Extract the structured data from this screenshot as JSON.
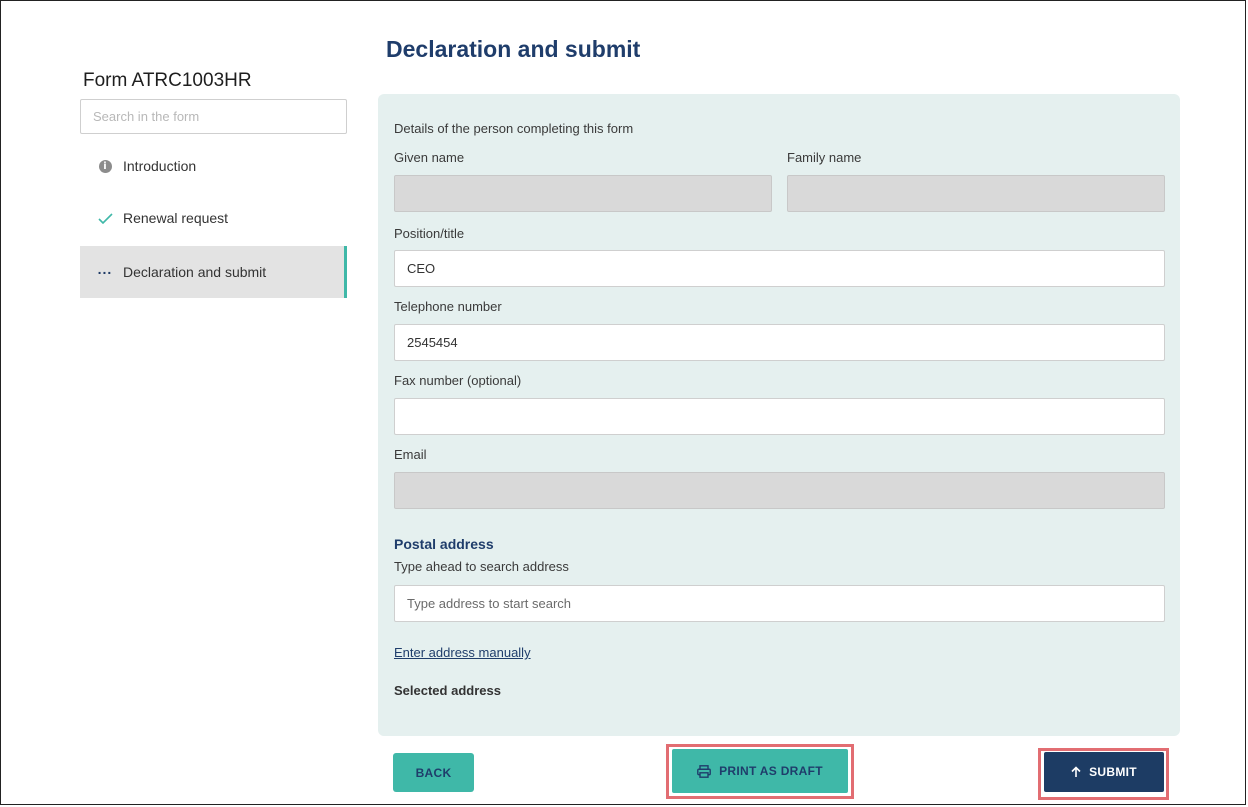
{
  "sidebar": {
    "form_title": "Form ATRC1003HR",
    "search_placeholder": "Search in the form",
    "items": [
      {
        "label": "Introduction",
        "icon": "info-icon",
        "state": "info"
      },
      {
        "label": "Renewal request",
        "icon": "check-icon",
        "state": "complete"
      },
      {
        "label": "Declaration and submit",
        "icon": "more-dots-icon",
        "state": "in-progress"
      }
    ]
  },
  "main": {
    "title": "Declaration and submit",
    "section_intro": "Details of the person completing this form",
    "fields": {
      "given_name": {
        "label": "Given name",
        "value": ""
      },
      "family_name": {
        "label": "Family name",
        "value": ""
      },
      "position": {
        "label": "Position/title",
        "value": "CEO"
      },
      "telephone": {
        "label": "Telephone number",
        "value": "2545454"
      },
      "fax": {
        "label": "Fax number (optional)",
        "value": ""
      },
      "email": {
        "label": "Email",
        "value": ""
      }
    },
    "postal": {
      "heading": "Postal address",
      "hint": "Type ahead to search address",
      "placeholder": "Type address to start search",
      "manual_link": "Enter address manually",
      "selected_label": "Selected address"
    }
  },
  "buttons": {
    "back": "BACK",
    "print": "PRINT AS DRAFT",
    "submit": "SUBMIT"
  },
  "colors": {
    "accent_teal": "#3fb8a8",
    "navy": "#1d3c64",
    "panel_bg": "#e5f0ef",
    "highlight": "#e26d72"
  }
}
